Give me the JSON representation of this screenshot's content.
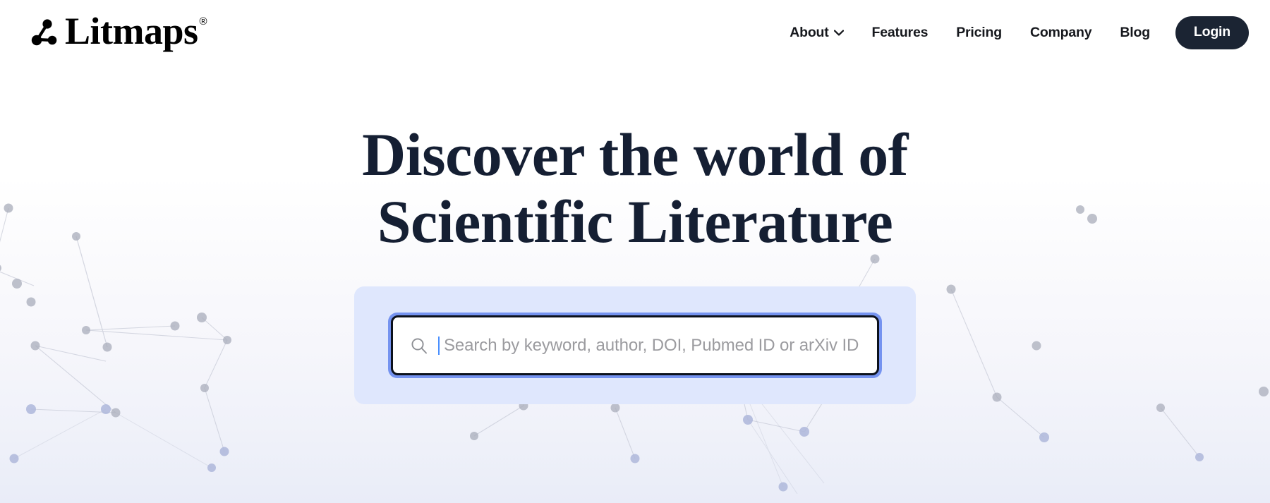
{
  "brand": {
    "name": "Litmaps",
    "registered_mark": "®",
    "logo_icon": "node-graph-icon"
  },
  "nav": {
    "items": [
      {
        "label": "About",
        "has_dropdown": true,
        "icon": "chevron-down-icon"
      },
      {
        "label": "Features",
        "has_dropdown": false
      },
      {
        "label": "Pricing",
        "has_dropdown": false
      },
      {
        "label": "Company",
        "has_dropdown": false
      },
      {
        "label": "Blog",
        "has_dropdown": false
      }
    ],
    "login_label": "Login"
  },
  "hero": {
    "headline_line1": "Discover the world of",
    "headline_line2": "Scientific Literature"
  },
  "search": {
    "placeholder": "Search by keyword, author, DOI, Pubmed ID or arXiv ID",
    "value": "",
    "icon": "search-icon",
    "focused": true
  },
  "colors": {
    "text_dark": "#151f33",
    "login_bg": "#1b2433",
    "login_text": "#ffffff",
    "search_panel_bg": "#dfe7fd",
    "search_focus_ring": "#7593f0",
    "search_border": "#0c111c",
    "placeholder_text": "#9b9b9f",
    "caret": "#4a90ff",
    "page_bg": "#ffffff",
    "hero_gradient_end": "#e9ecf8",
    "network_node": "#a9adbb",
    "network_node_blue": "#aeb7db"
  },
  "background": {
    "graphic": "citation-network-constellation"
  }
}
